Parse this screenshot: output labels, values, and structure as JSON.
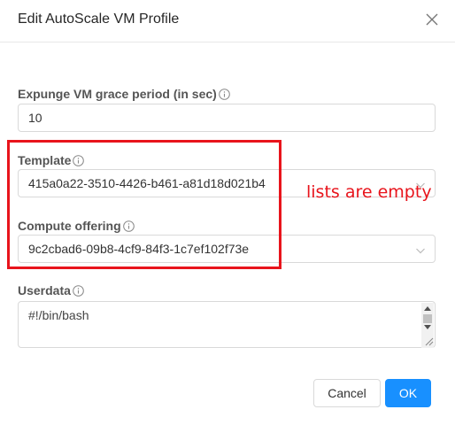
{
  "dialog": {
    "title": "Edit AutoScale VM Profile"
  },
  "fields": {
    "expunge": {
      "label": "Expunge VM grace period (in sec)",
      "value": "10"
    },
    "template": {
      "label": "Template",
      "value": "415a0a22-3510-4426-b461-a81d18d021b4"
    },
    "compute": {
      "label": "Compute offering",
      "value": "9c2cbad6-09b8-4cf9-84f3-1c7ef102f73e"
    },
    "userdata": {
      "label": "Userdata",
      "value": "#!/bin/bash"
    }
  },
  "annotation": {
    "text": "lists are empty",
    "color": "#e8141c"
  },
  "footer": {
    "cancel_label": "Cancel",
    "ok_label": "OK"
  },
  "colors": {
    "primary": "#1890ff",
    "border": "#d9d9d9"
  },
  "icons": {
    "close": "close-icon",
    "info": "info-circle-icon",
    "dropdown": "chevron-down-icon"
  }
}
